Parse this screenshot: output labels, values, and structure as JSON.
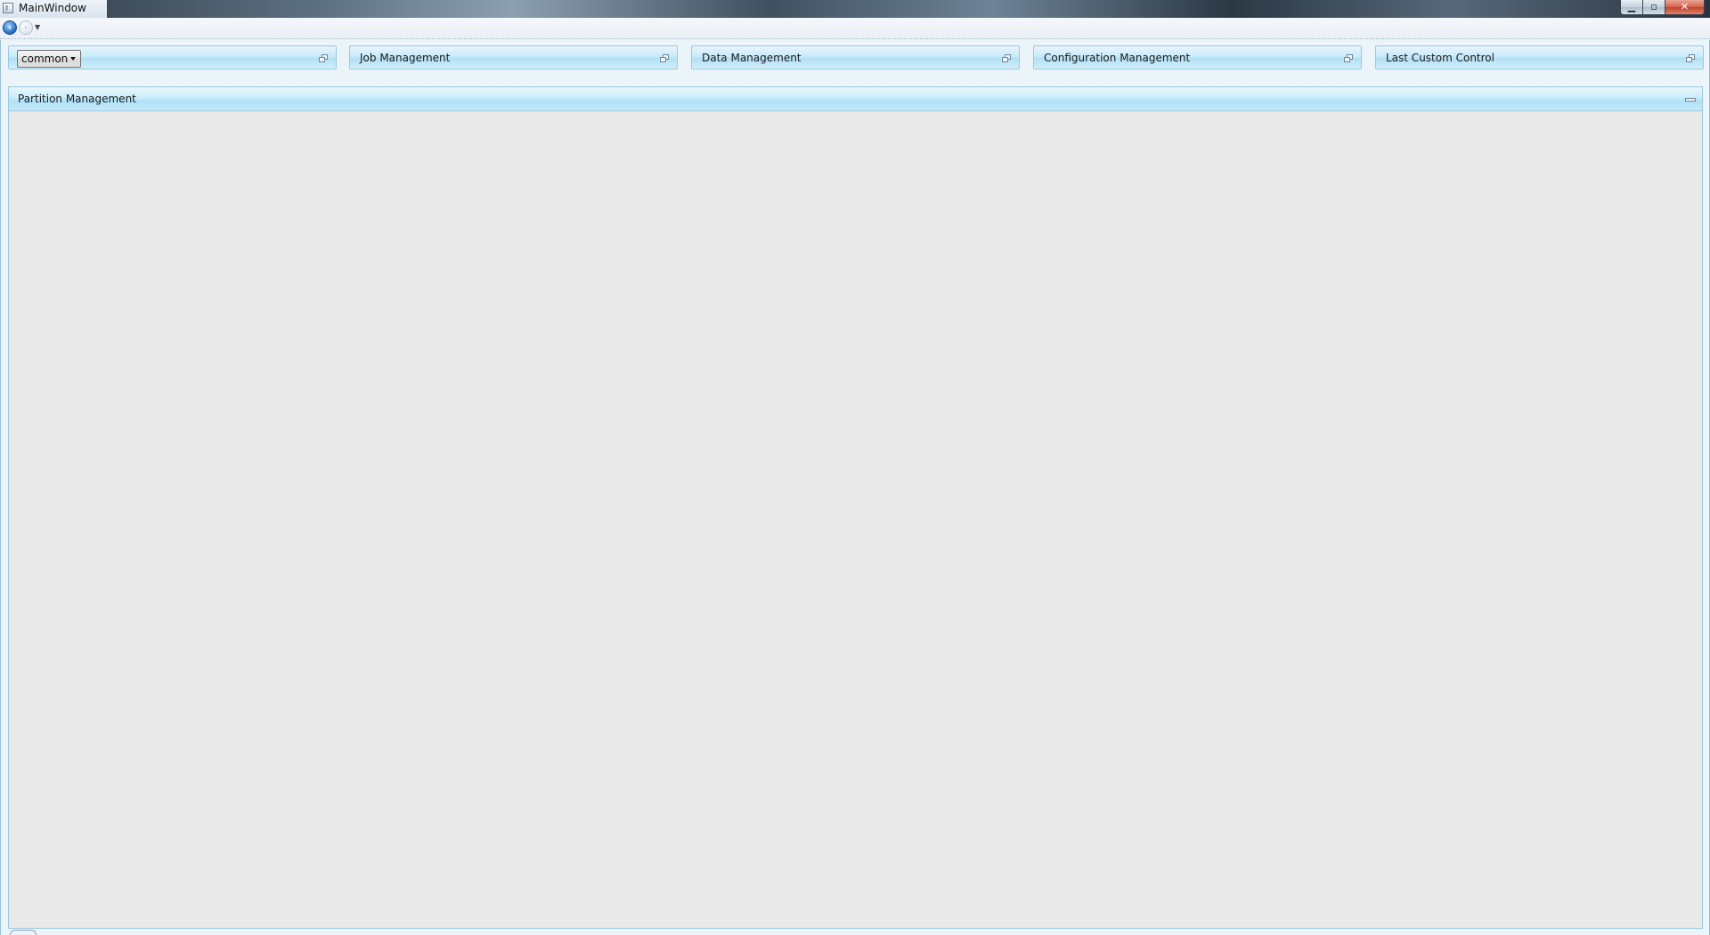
{
  "window": {
    "title": "MainWindow",
    "caption_buttons": {
      "minimize_icon": "minimize-icon",
      "maximize_icon": "maximize-icon",
      "close_icon": "close-icon",
      "close_glyph": "✕"
    }
  },
  "nav": {
    "back_icon": "back-arrow-icon",
    "forward_icon": "forward-arrow-icon",
    "dropdown_icon": "chevron-down-icon"
  },
  "dock_panels": [
    {
      "label": "",
      "combo_value": "common",
      "icon": "restore-icon"
    },
    {
      "label": "Job Management",
      "icon": "restore-icon"
    },
    {
      "label": "Data Management",
      "icon": "restore-icon"
    },
    {
      "label": "Configuration Management",
      "icon": "restore-icon"
    },
    {
      "label": "Last Custom Control",
      "icon": "restore-icon"
    }
  ],
  "main_panel": {
    "title": "Partition Management",
    "icon": "minimize-icon"
  },
  "colors": {
    "panel_header": "#c9ebfa",
    "panel_border": "#9cc8e0",
    "body_background": "#e9e9e9",
    "close_button": "#d5604b"
  }
}
